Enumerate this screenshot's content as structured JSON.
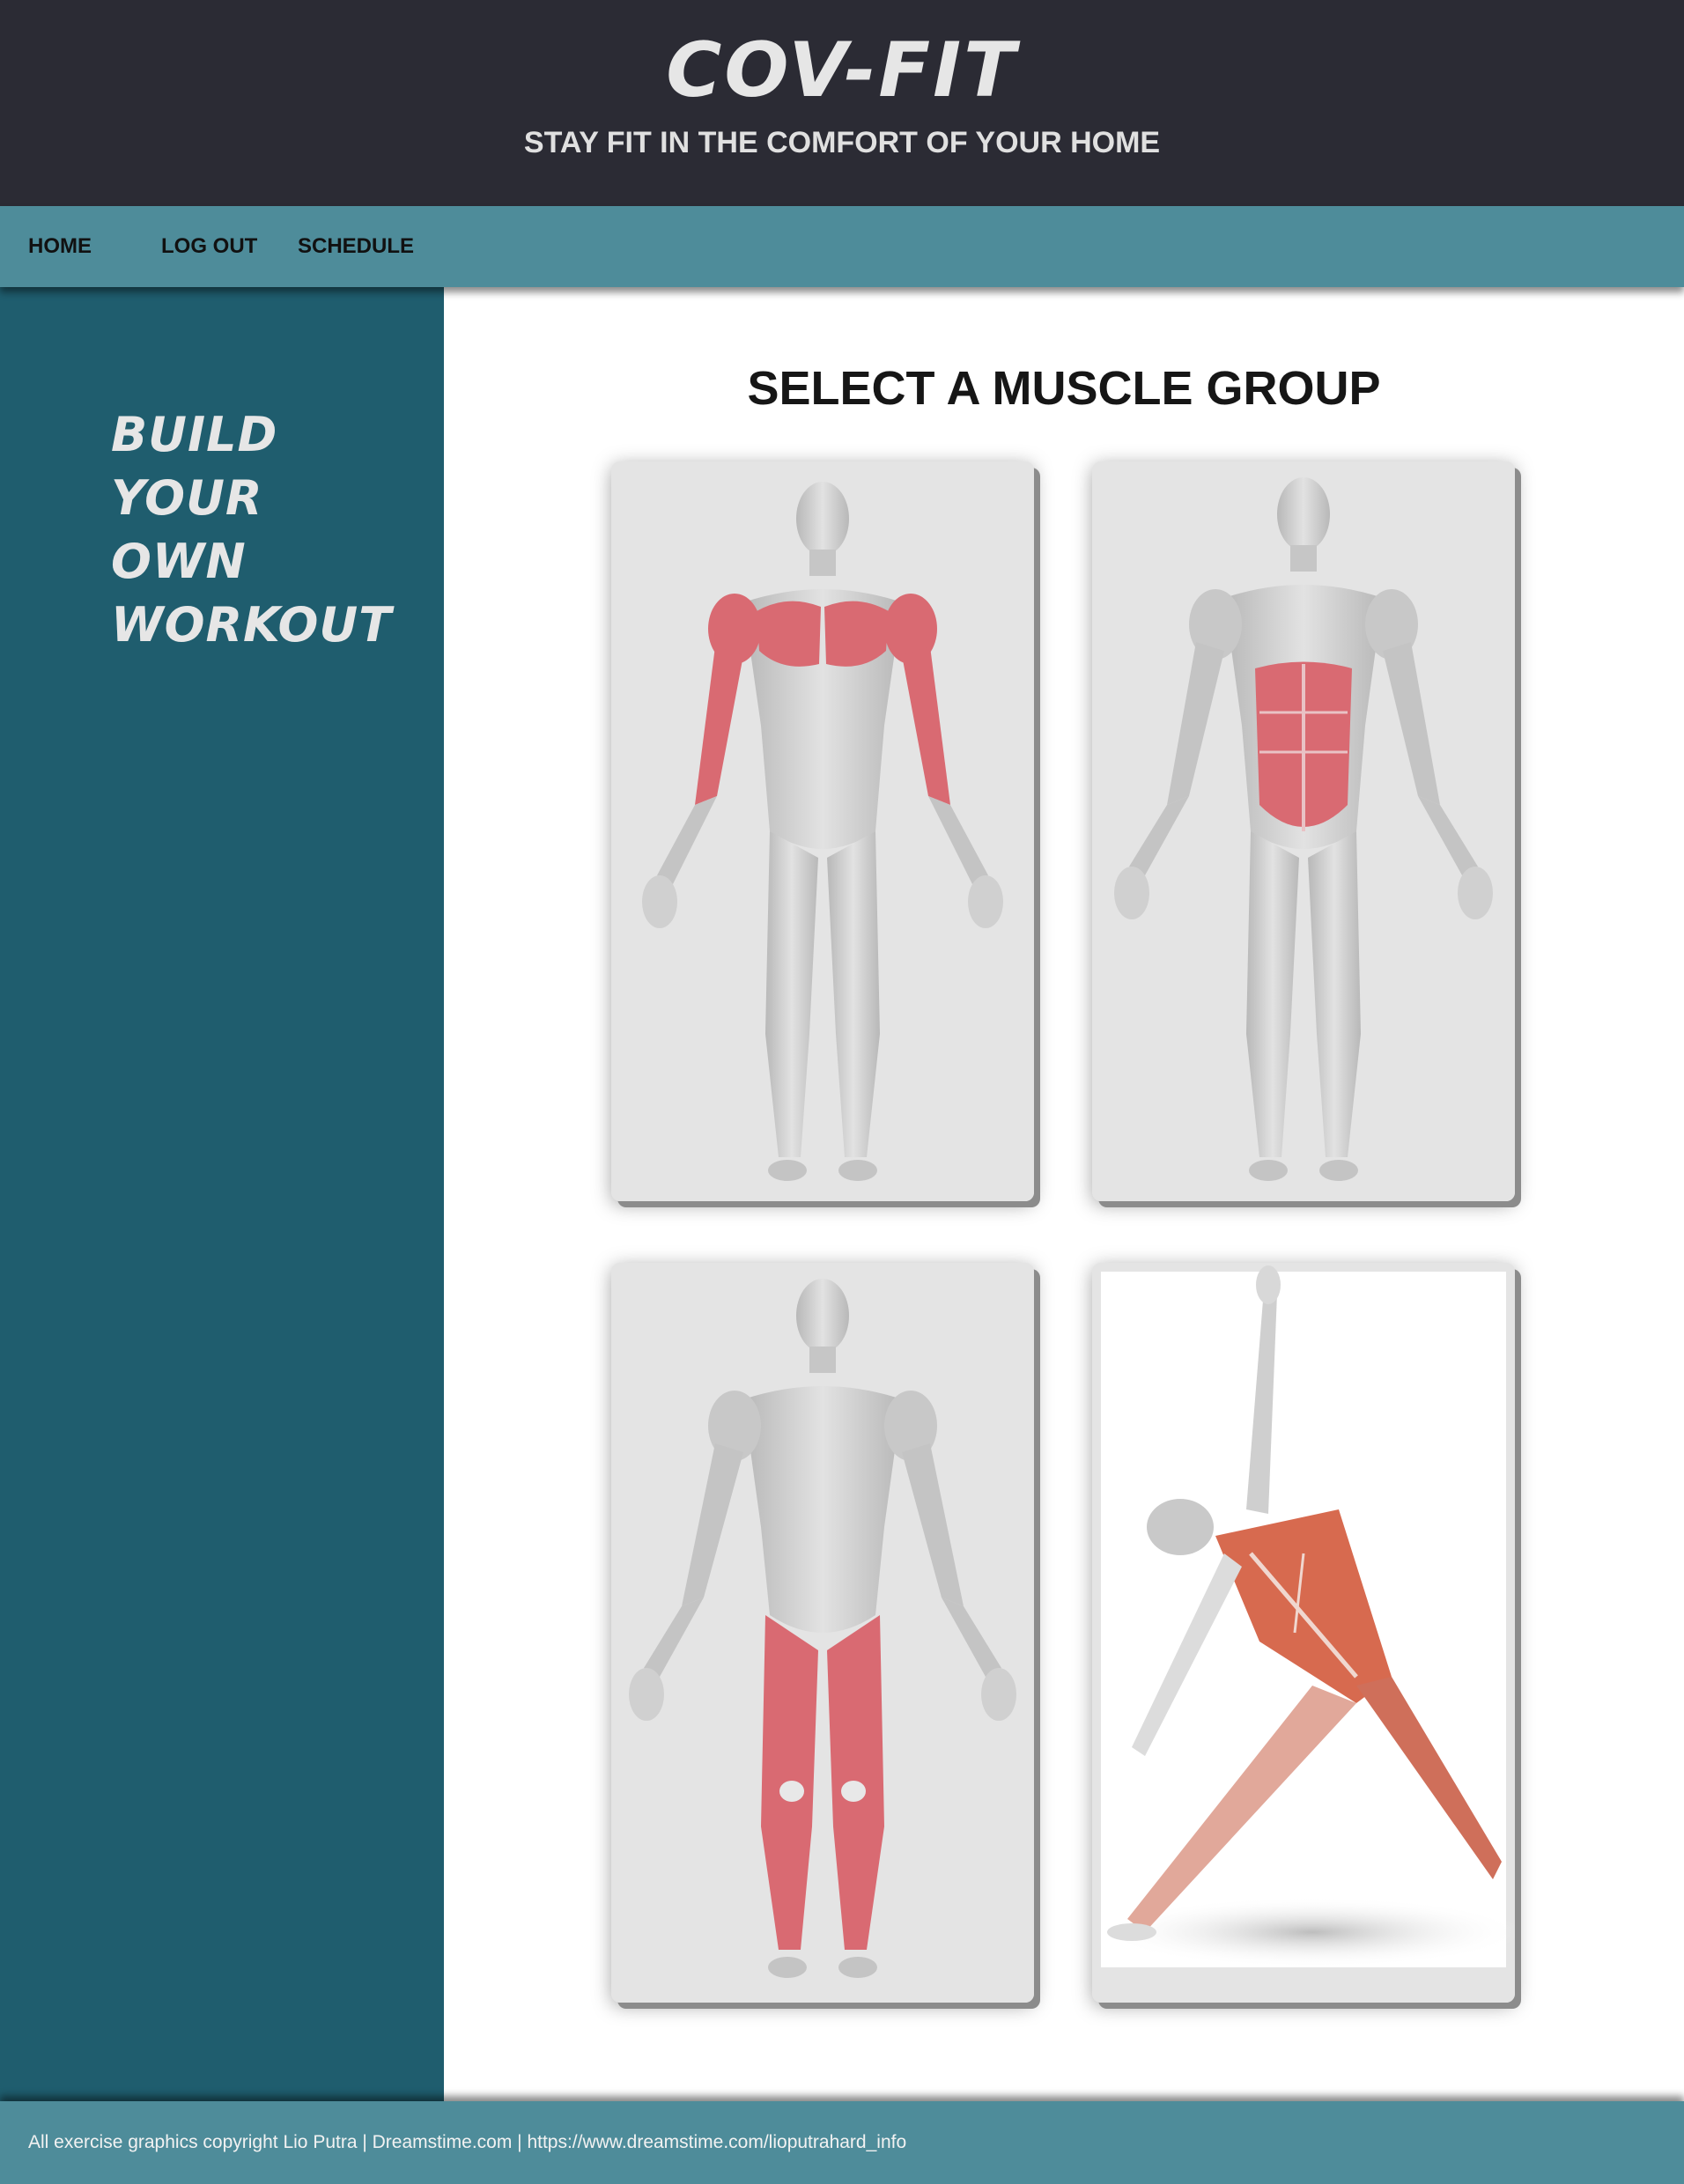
{
  "header": {
    "title": "COV-FIT",
    "tagline": "STAY FIT IN THE COMFORT OF YOUR HOME"
  },
  "nav": {
    "home": "HOME",
    "logout": "LOG OUT",
    "schedule": "SCHEDULE"
  },
  "sidebar": {
    "slogan": [
      "BUILD",
      "YOUR",
      "OWN",
      "WORKOUT"
    ]
  },
  "main": {
    "title": "SELECT A MUSCLE GROUP",
    "cards": [
      {
        "name": "muscle-card-upper-body",
        "highlight": "chest-arms"
      },
      {
        "name": "muscle-card-core",
        "highlight": "abs"
      },
      {
        "name": "muscle-card-legs",
        "highlight": "legs"
      },
      {
        "name": "muscle-card-stretch",
        "highlight": "full-body-stretch"
      }
    ]
  },
  "footer": {
    "text": "All exercise graphics copyright Lio Putra | Dreamstime.com | https://www.dreamstime.com/lioputrahard_info"
  },
  "colors": {
    "header_bg": "#2b2b34",
    "nav_bg": "#4e8c9a",
    "sidebar_bg": "#1f5d6e",
    "muscle_highlight": "#d96a72",
    "body_grey": "#c9c9c9"
  }
}
